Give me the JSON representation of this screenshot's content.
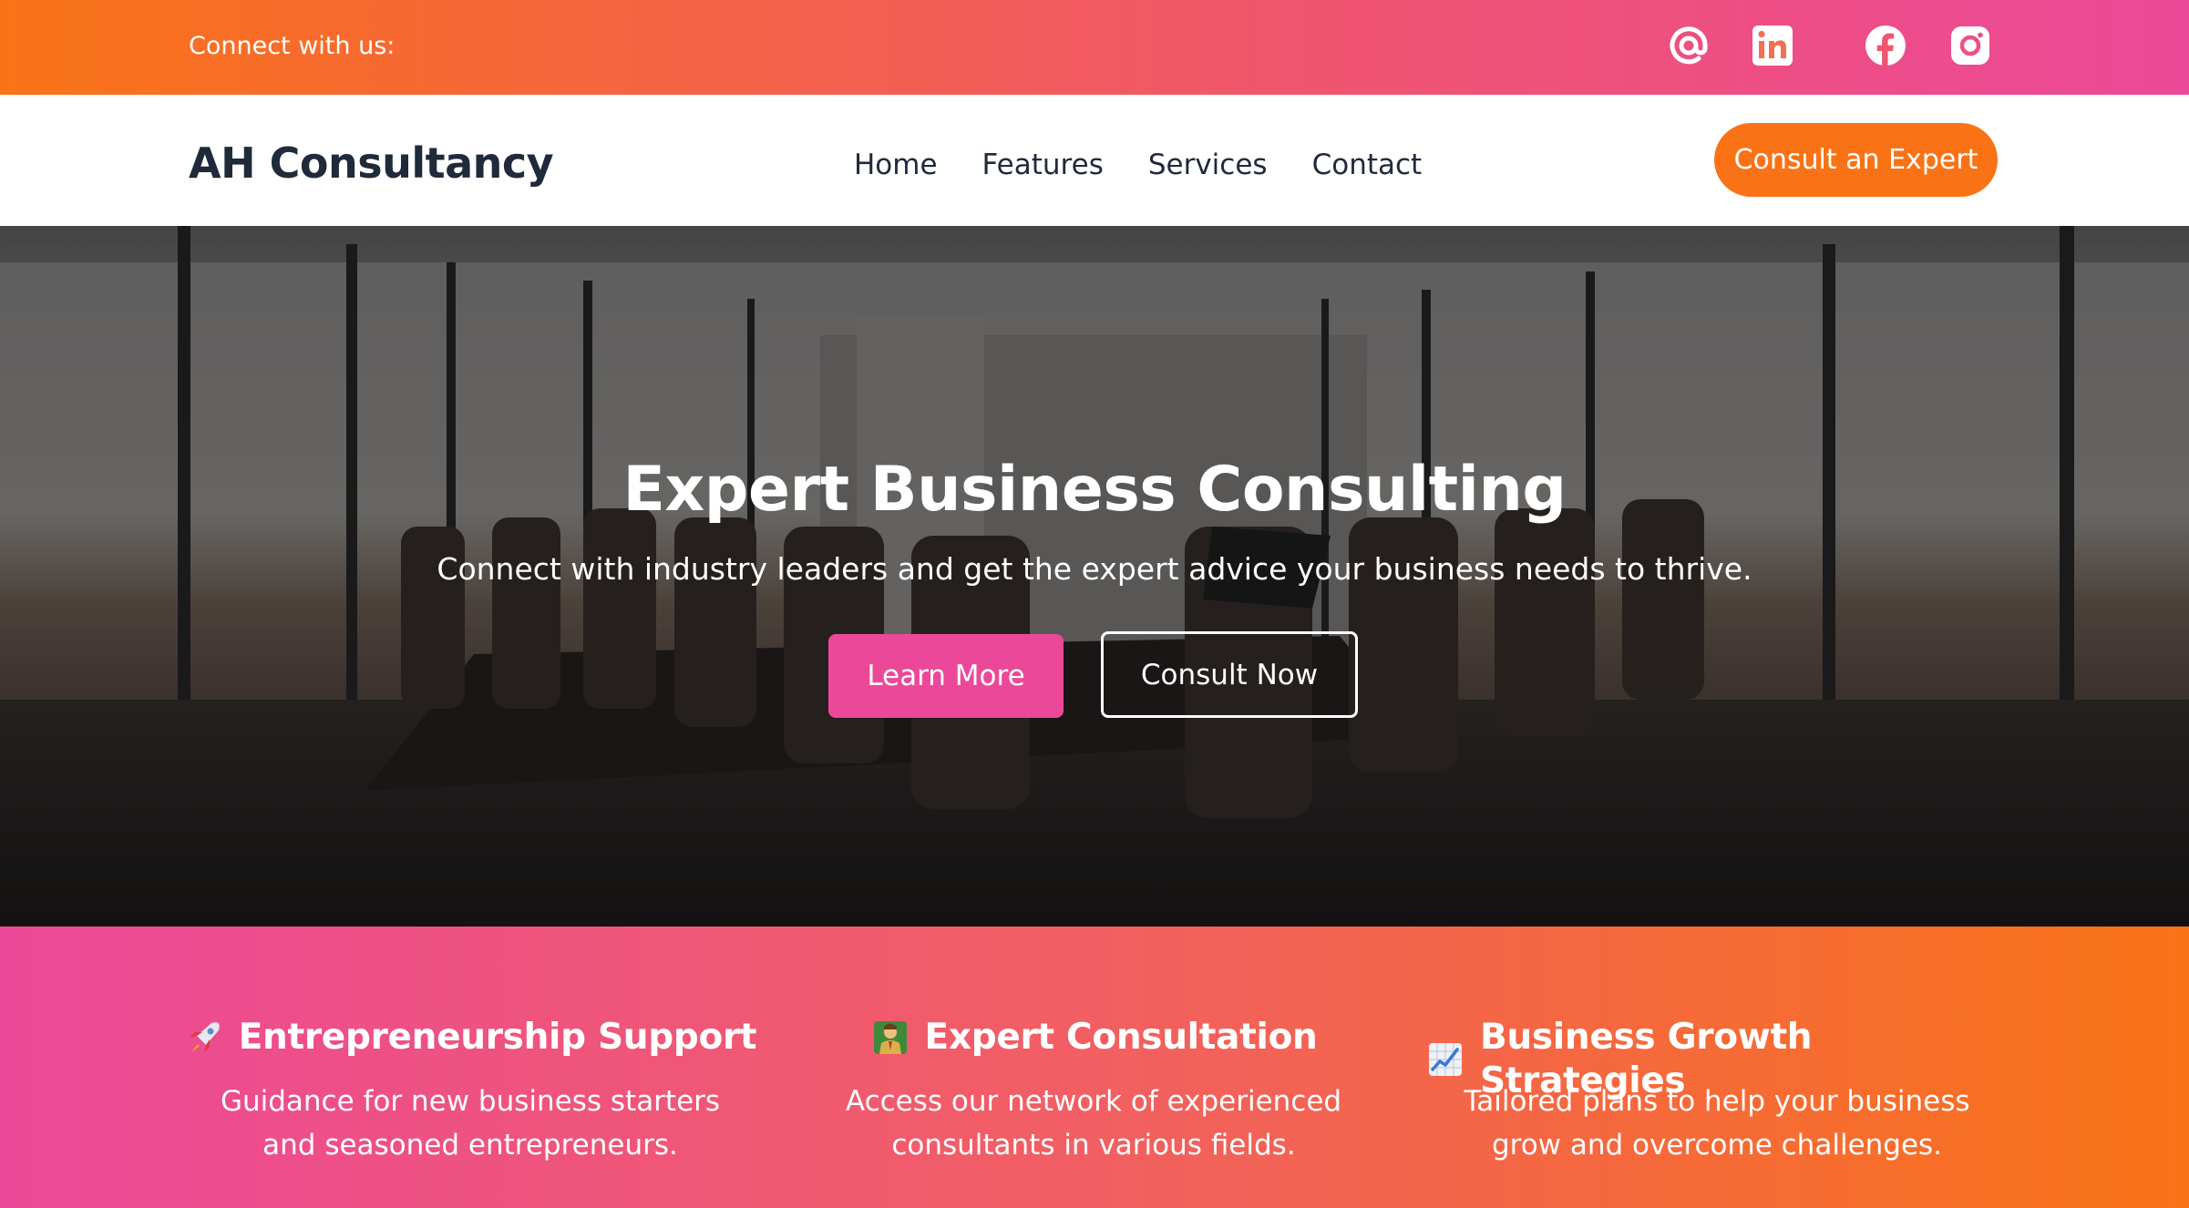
{
  "topbar": {
    "connect_text": "Connect with us:",
    "social": [
      {
        "name": "email-icon"
      },
      {
        "name": "linkedin-icon"
      },
      {
        "name": "facebook-icon"
      },
      {
        "name": "instagram-icon"
      }
    ]
  },
  "nav": {
    "brand": "AH Consultancy",
    "links": [
      "Home",
      "Features",
      "Services",
      "Contact"
    ],
    "cta": "Consult an Expert"
  },
  "hero": {
    "title": "Expert Business Consulting",
    "subtitle": "Connect with industry leaders and get the expert advice your business needs to thrive.",
    "primary_button": "Learn More",
    "secondary_button": "Consult Now"
  },
  "features": [
    {
      "icon": "rocket-icon",
      "title": "Entrepreneurship Support",
      "description": "Guidance for new business starters and seasoned entrepreneurs."
    },
    {
      "icon": "consultant-icon",
      "title": "Expert Consultation",
      "description": "Access our network of experienced consultants in various fields."
    },
    {
      "icon": "chart-increasing-icon",
      "title": "Business Growth Strategies",
      "description": "Tailored plans to help your business grow and overcome challenges."
    }
  ],
  "colors": {
    "orange": "#f97316",
    "pink": "#ec4899",
    "dark_text": "#1f2a3a"
  }
}
